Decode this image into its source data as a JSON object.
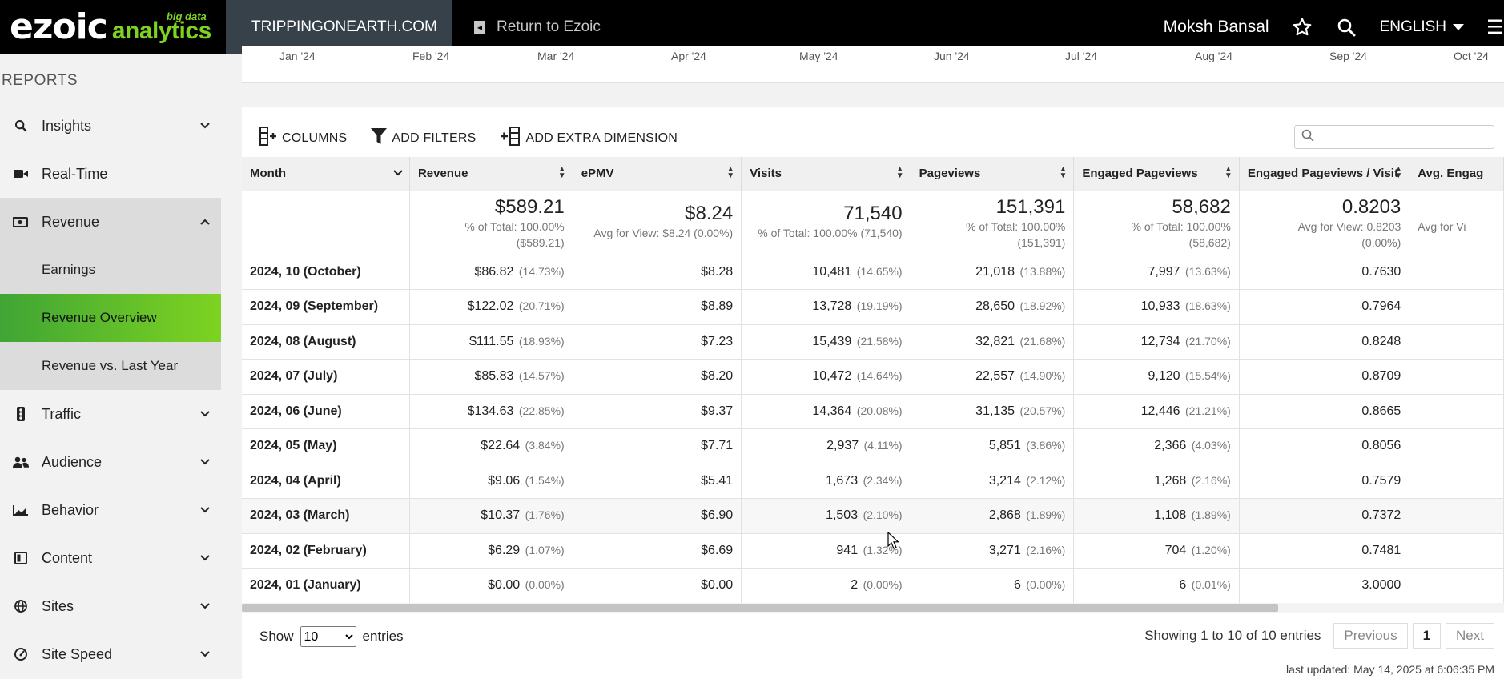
{
  "topbar": {
    "logo_main": "ezoic",
    "logo_sub_top": "big data",
    "logo_sub_bottom": "analytics",
    "site_name": "TRIPPINGONEARTH.COM",
    "return_label": "Return to Ezoic",
    "user_name": "Moksh Bansal",
    "language": "ENGLISH"
  },
  "sidebar": {
    "section_label": "REPORTS",
    "items": [
      {
        "label": "Insights",
        "icon": "search-icon"
      },
      {
        "label": "Real-Time",
        "icon": "video-icon"
      },
      {
        "label": "Revenue",
        "icon": "money-icon"
      },
      {
        "label": "Traffic",
        "icon": "traffic-light-icon"
      },
      {
        "label": "Audience",
        "icon": "users-icon"
      },
      {
        "label": "Behavior",
        "icon": "chart-area-icon"
      },
      {
        "label": "Content",
        "icon": "book-icon"
      },
      {
        "label": "Sites",
        "icon": "globe-icon"
      },
      {
        "label": "Site Speed",
        "icon": "gauge-icon"
      }
    ],
    "revenue_sub": [
      {
        "label": "Earnings"
      },
      {
        "label": "Revenue Overview"
      },
      {
        "label": "Revenue vs. Last Year"
      }
    ]
  },
  "chart_axis": {
    "months": [
      "Jan '24",
      "Feb '24",
      "Mar '24",
      "Apr '24",
      "May '24",
      "Jun '24",
      "Jul '24",
      "Aug '24",
      "Sep '24",
      "Oct '24"
    ]
  },
  "toolbar": {
    "columns_label": "COLUMNS",
    "filters_label": "ADD FILTERS",
    "dimension_label": "ADD EXTRA DIMENSION"
  },
  "table": {
    "headers": [
      "Month",
      "Revenue",
      "ePMV",
      "Visits",
      "Pageviews",
      "Engaged Pageviews",
      "Engaged Pageviews / Visit",
      "Avg. Engag"
    ],
    "totals": {
      "revenue": {
        "big": "$589.21",
        "l1": "% of Total: 100.00%",
        "l2": "($589.21)"
      },
      "epmv": {
        "big": "$8.24",
        "l1": "Avg for View: $8.24 (0.00%)"
      },
      "visits": {
        "big": "71,540",
        "l1": "% of Total: 100.00% (71,540)"
      },
      "pageviews": {
        "big": "151,391",
        "l1": "% of Total: 100.00%",
        "l2": "(151,391)"
      },
      "engaged": {
        "big": "58,682",
        "l1": "% of Total: 100.00%",
        "l2": "(58,682)"
      },
      "epv": {
        "big": "0.8203",
        "l1": "Avg for View: 0.8203",
        "l2": "(0.00%)"
      },
      "avg_eng": {
        "l1": "Avg for Vi"
      }
    },
    "rows": [
      {
        "month": "2024, 10 (October)",
        "revenue": "$86.82",
        "revenue_pct": "(14.73%)",
        "epmv": "$8.28",
        "visits": "10,481",
        "visits_pct": "(14.65%)",
        "pageviews": "21,018",
        "pageviews_pct": "(13.88%)",
        "engaged": "7,997",
        "engaged_pct": "(13.63%)",
        "epv": "0.7630"
      },
      {
        "month": "2024, 09 (September)",
        "revenue": "$122.02",
        "revenue_pct": "(20.71%)",
        "epmv": "$8.89",
        "visits": "13,728",
        "visits_pct": "(19.19%)",
        "pageviews": "28,650",
        "pageviews_pct": "(18.92%)",
        "engaged": "10,933",
        "engaged_pct": "(18.63%)",
        "epv": "0.7964"
      },
      {
        "month": "2024, 08 (August)",
        "revenue": "$111.55",
        "revenue_pct": "(18.93%)",
        "epmv": "$7.23",
        "visits": "15,439",
        "visits_pct": "(21.58%)",
        "pageviews": "32,821",
        "pageviews_pct": "(21.68%)",
        "engaged": "12,734",
        "engaged_pct": "(21.70%)",
        "epv": "0.8248"
      },
      {
        "month": "2024, 07 (July)",
        "revenue": "$85.83",
        "revenue_pct": "(14.57%)",
        "epmv": "$8.20",
        "visits": "10,472",
        "visits_pct": "(14.64%)",
        "pageviews": "22,557",
        "pageviews_pct": "(14.90%)",
        "engaged": "9,120",
        "engaged_pct": "(15.54%)",
        "epv": "0.8709"
      },
      {
        "month": "2024, 06 (June)",
        "revenue": "$134.63",
        "revenue_pct": "(22.85%)",
        "epmv": "$9.37",
        "visits": "14,364",
        "visits_pct": "(20.08%)",
        "pageviews": "31,135",
        "pageviews_pct": "(20.57%)",
        "engaged": "12,446",
        "engaged_pct": "(21.21%)",
        "epv": "0.8665"
      },
      {
        "month": "2024, 05 (May)",
        "revenue": "$22.64",
        "revenue_pct": "(3.84%)",
        "epmv": "$7.71",
        "visits": "2,937",
        "visits_pct": "(4.11%)",
        "pageviews": "5,851",
        "pageviews_pct": "(3.86%)",
        "engaged": "2,366",
        "engaged_pct": "(4.03%)",
        "epv": "0.8056"
      },
      {
        "month": "2024, 04 (April)",
        "revenue": "$9.06",
        "revenue_pct": "(1.54%)",
        "epmv": "$5.41",
        "visits": "1,673",
        "visits_pct": "(2.34%)",
        "pageviews": "3,214",
        "pageviews_pct": "(2.12%)",
        "engaged": "1,268",
        "engaged_pct": "(2.16%)",
        "epv": "0.7579"
      },
      {
        "month": "2024, 03 (March)",
        "revenue": "$10.37",
        "revenue_pct": "(1.76%)",
        "epmv": "$6.90",
        "visits": "1,503",
        "visits_pct": "(2.10%)",
        "pageviews": "2,868",
        "pageviews_pct": "(1.89%)",
        "engaged": "1,108",
        "engaged_pct": "(1.89%)",
        "epv": "0.7372"
      },
      {
        "month": "2024, 02 (February)",
        "revenue": "$6.29",
        "revenue_pct": "(1.07%)",
        "epmv": "$6.69",
        "visits": "941",
        "visits_pct": "(1.32%)",
        "pageviews": "3,271",
        "pageviews_pct": "(2.16%)",
        "engaged": "704",
        "engaged_pct": "(1.20%)",
        "epv": "0.7481"
      },
      {
        "month": "2024, 01 (January)",
        "revenue": "$0.00",
        "revenue_pct": "(0.00%)",
        "epmv": "$0.00",
        "visits": "2",
        "visits_pct": "(0.00%)",
        "pageviews": "6",
        "pageviews_pct": "(0.00%)",
        "engaged": "6",
        "engaged_pct": "(0.01%)",
        "epv": "3.0000"
      }
    ]
  },
  "footer": {
    "show_label": "Show",
    "entries_value": "10",
    "entries_label": "entries",
    "info": "Showing 1 to 10 of 10 entries",
    "prev": "Previous",
    "page": "1",
    "next": "Next",
    "last_updated": "last updated: May 14, 2025 at 6:06:35 PM"
  },
  "colors": {
    "topbar_bg": "#000000",
    "site_tab_bg": "#37414a",
    "brand_green": "#7ed321",
    "active_gradient_start": "#3fa535"
  }
}
